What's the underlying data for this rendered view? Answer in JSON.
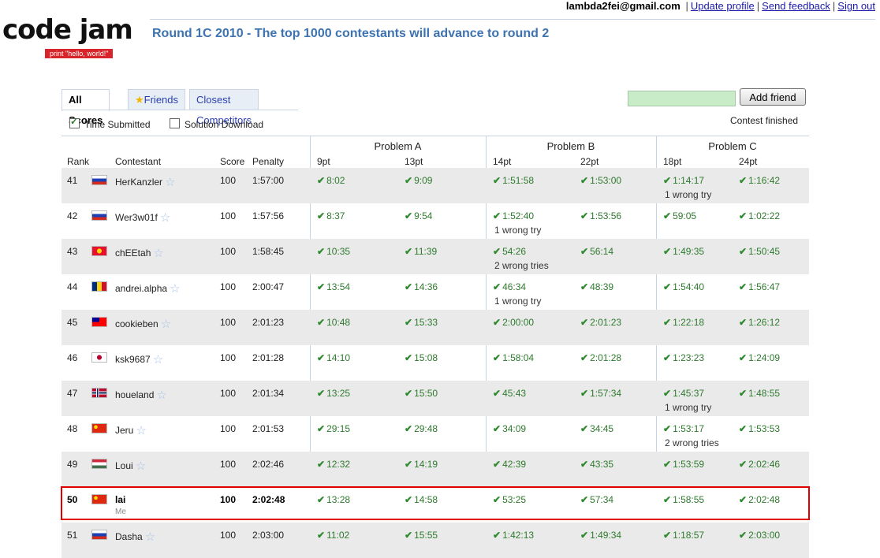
{
  "user": {
    "email": "lambda2fei@gmail.com",
    "links": [
      "Update profile",
      "Send feedback",
      "Sign out"
    ]
  },
  "logo": {
    "title": "code jam",
    "tagline": "print \"hello, world!\""
  },
  "headline": "Round 1C 2010 - The top 1000 contestants will advance to round 2",
  "tabs": {
    "all": "All Scores",
    "friends": "Friends",
    "closest": "Closest Competitors"
  },
  "add_friend": {
    "label": "Add friend",
    "value": ""
  },
  "options": {
    "time_submitted": "Time Submitted",
    "time_submitted_checked": true,
    "solution_download": "Solution Download",
    "solution_download_checked": false
  },
  "status": "Contest finished",
  "columns": {
    "rank": "Rank",
    "contestant": "Contestant",
    "score": "Score",
    "penalty": "Penalty"
  },
  "problems": [
    {
      "title": "Problem A",
      "parts": [
        "9pt",
        "13pt"
      ]
    },
    {
      "title": "Problem B",
      "parts": [
        "14pt",
        "22pt"
      ]
    },
    {
      "title": "Problem C",
      "parts": [
        "18pt",
        "24pt"
      ]
    }
  ],
  "me_label": "Me",
  "rows": [
    {
      "rank": "41",
      "flag": "russia",
      "name": "HerKanzler",
      "score": "100",
      "penalty": "1:57:00",
      "times": [
        "8:02",
        "9:09",
        "1:51:58",
        "1:53:00",
        "1:14:17",
        "1:16:42"
      ],
      "wrong": [
        "",
        "",
        "",
        "",
        "1 wrong try",
        ""
      ]
    },
    {
      "rank": "42",
      "flag": "russia",
      "name": "Wer3w01f",
      "score": "100",
      "penalty": "1:57:56",
      "times": [
        "8:37",
        "9:54",
        "1:52:40",
        "1:53:56",
        "59:05",
        "1:02:22"
      ],
      "wrong": [
        "",
        "",
        "1 wrong try",
        "",
        "",
        ""
      ]
    },
    {
      "rank": "43",
      "flag": "kyrgyzstan",
      "name": "chEEtah",
      "score": "100",
      "penalty": "1:58:45",
      "times": [
        "10:35",
        "11:39",
        "54:26",
        "56:14",
        "1:49:35",
        "1:50:45"
      ],
      "wrong": [
        "",
        "",
        "2 wrong tries",
        "",
        "",
        ""
      ]
    },
    {
      "rank": "44",
      "flag": "romania",
      "name": "andrei.alpha",
      "score": "100",
      "penalty": "2:00:47",
      "times": [
        "13:54",
        "14:36",
        "46:34",
        "48:39",
        "1:54:40",
        "1:56:47"
      ],
      "wrong": [
        "",
        "",
        "1 wrong try",
        "",
        "",
        ""
      ]
    },
    {
      "rank": "45",
      "flag": "taiwan",
      "name": "cookieben",
      "score": "100",
      "penalty": "2:01:23",
      "times": [
        "10:48",
        "15:33",
        "2:00:00",
        "2:01:23",
        "1:22:18",
        "1:26:12"
      ],
      "wrong": [
        "",
        "",
        "",
        "",
        "",
        ""
      ]
    },
    {
      "rank": "46",
      "flag": "japan",
      "name": "ksk9687",
      "score": "100",
      "penalty": "2:01:28",
      "times": [
        "14:10",
        "15:08",
        "1:58:04",
        "2:01:28",
        "1:23:23",
        "1:24:09"
      ],
      "wrong": [
        "",
        "",
        "",
        "",
        "",
        ""
      ]
    },
    {
      "rank": "47",
      "flag": "norway",
      "name": "houeland",
      "score": "100",
      "penalty": "2:01:34",
      "times": [
        "13:25",
        "15:50",
        "45:43",
        "1:57:34",
        "1:45:37",
        "1:48:55"
      ],
      "wrong": [
        "",
        "",
        "",
        "",
        "1 wrong try",
        ""
      ]
    },
    {
      "rank": "48",
      "flag": "china",
      "name": "Jeru",
      "score": "100",
      "penalty": "2:01:53",
      "times": [
        "29:15",
        "29:48",
        "34:09",
        "34:45",
        "1:53:17",
        "1:53:53"
      ],
      "wrong": [
        "",
        "",
        "",
        "",
        "2 wrong tries",
        ""
      ]
    },
    {
      "rank": "49",
      "flag": "hungary",
      "name": "Loui",
      "score": "100",
      "penalty": "2:02:46",
      "times": [
        "12:32",
        "14:19",
        "42:39",
        "43:35",
        "1:53:59",
        "2:02:46"
      ],
      "wrong": [
        "",
        "",
        "",
        "",
        "",
        ""
      ]
    },
    {
      "rank": "50",
      "flag": "china",
      "name": "lai",
      "score": "100",
      "penalty": "2:02:48",
      "me": true,
      "times": [
        "13:28",
        "14:58",
        "53:25",
        "57:34",
        "1:58:55",
        "2:02:48"
      ],
      "wrong": [
        "",
        "",
        "",
        "",
        "",
        ""
      ]
    },
    {
      "rank": "51",
      "flag": "russia",
      "name": "Dasha",
      "score": "100",
      "penalty": "2:03:00",
      "times": [
        "11:02",
        "15:55",
        "1:42:13",
        "1:49:34",
        "1:18:57",
        "2:03:00"
      ],
      "wrong": [
        "",
        "",
        "",
        "",
        "",
        ""
      ]
    }
  ],
  "colors": {
    "accent": "#3d73b0",
    "solved": "#2e7a2e",
    "highlight": "#e00000",
    "row_shade": "#eaeaea",
    "friend_input": "#c8ecc8"
  }
}
